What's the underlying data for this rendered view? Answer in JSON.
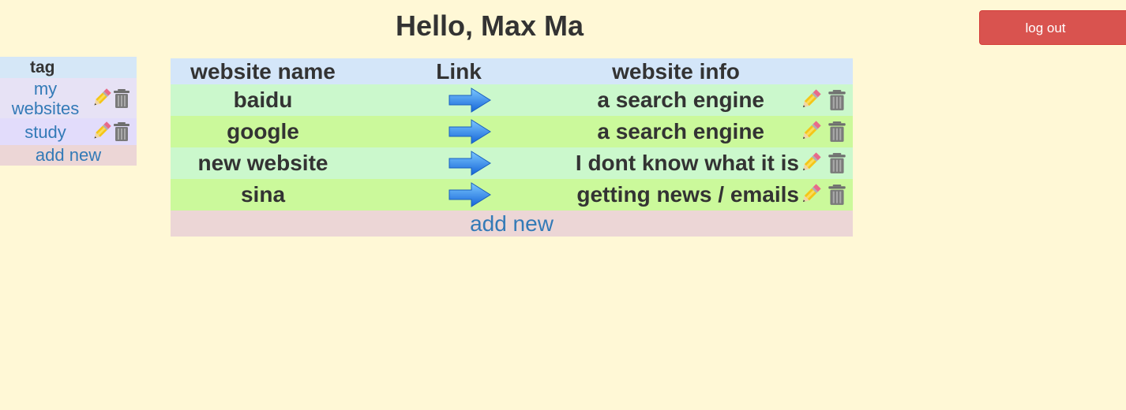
{
  "header": {
    "greeting": "Hello, Max Ma",
    "logout_label": "log out"
  },
  "colors": {
    "background": "#fff8d6",
    "logout": "#d9534f",
    "link": "#337ab7",
    "header_row": "#d4e6f9",
    "row_light": "#cbf8cc",
    "row_dark": "#cbf99b",
    "add_row": "#ecd6d6"
  },
  "tags": {
    "header": "tag",
    "items": [
      {
        "label": "my websites"
      },
      {
        "label": "study"
      }
    ],
    "add_label": "add new"
  },
  "sites": {
    "columns": [
      "website name",
      "Link",
      "website info"
    ],
    "rows": [
      {
        "name": "baidu",
        "info": "a search engine"
      },
      {
        "name": "google",
        "info": "a search engine"
      },
      {
        "name": "new website",
        "info": "I dont know what it is"
      },
      {
        "name": "sina",
        "info": "getting news / emails"
      }
    ],
    "add_label": "add new"
  },
  "icons": {
    "edit": "pencil-icon",
    "delete": "trash-icon",
    "link": "arrow-right-icon"
  }
}
